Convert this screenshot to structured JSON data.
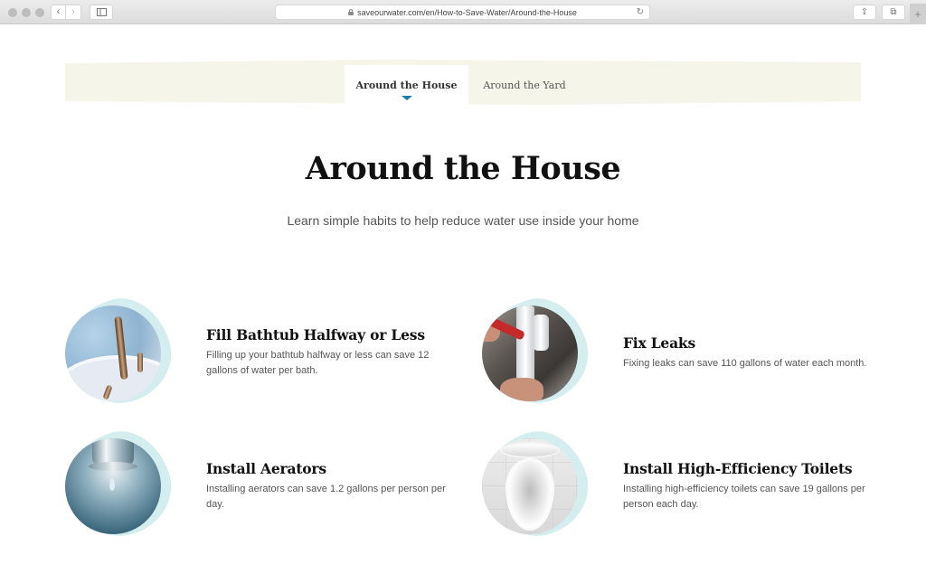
{
  "browser": {
    "url": "saveourwater.com/en/How-to-Save-Water/Around-the-House",
    "back_icon": "‹",
    "forward_icon": "›",
    "share_icon": "⇪",
    "tabs_icon": "⧉",
    "new_tab_icon": "+",
    "reload_icon": "↻"
  },
  "tabs": [
    {
      "label": "Around the House",
      "active": true
    },
    {
      "label": "Around the Yard",
      "active": false
    }
  ],
  "colors": {
    "tab_strip": "#f5f5e9",
    "active_indicator": "#1b7bab",
    "blob": "#d4eef0"
  },
  "hero": {
    "title": "Around the House",
    "subtitle": "Learn simple habits to help reduce water use inside your home"
  },
  "tips": [
    {
      "title": "Fill Bathtub Halfway or Less",
      "description": "Filling up your bathtub halfway or less can save 12 gallons of water per bath.",
      "image": "bathtub-faucet"
    },
    {
      "title": "Fix Leaks",
      "description": "Fixing leaks can save 110 gallons of water each month.",
      "image": "leaking-pipe-wrench"
    },
    {
      "title": "Install Aerators",
      "description": "Installing aerators can save 1.2 gallons per person per day.",
      "image": "faucet-aerator"
    },
    {
      "title": "Install High-Efficiency Toilets",
      "description": "Installing high-efficiency toilets can save 19 gallons per person each day.",
      "image": "toilet"
    }
  ]
}
